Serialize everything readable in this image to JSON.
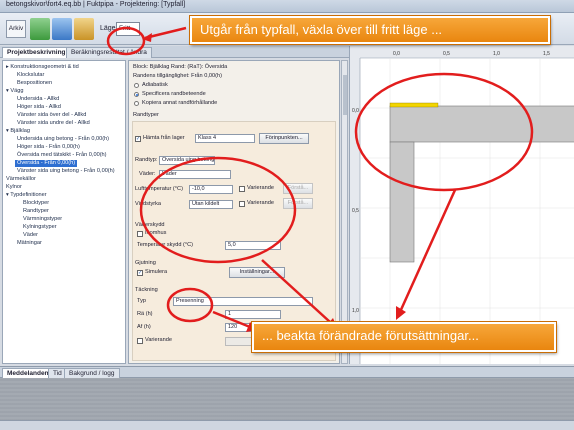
{
  "window": {
    "title": "betongskivor\\fort4.eq.bb | Fuktpipa - Projektering: [Typfall]"
  },
  "toolbar": {
    "arkiv_label": "Arkiv",
    "mode_label": "Läge",
    "mode_value": "Fritt"
  },
  "callouts": {
    "top": "Utgår från typfall, växla över till fritt läge ...",
    "bottom": "... beakta förändrade förutsättningar..."
  },
  "tabs": [
    {
      "label": "Projektbeskrivning"
    },
    {
      "label": "Beräkningsresultat / ändra"
    }
  ],
  "tree": {
    "items": [
      {
        "label": "▸ Konstruktionsgeometri & tid"
      },
      {
        "label": "Klockslutar"
      },
      {
        "label": "Bespositionen"
      },
      {
        "label": "▾ Vägg"
      },
      {
        "label": "Undersida - Allkd"
      },
      {
        "label": "Höger sida - Allkd"
      },
      {
        "label": "Vänster sida över del - Allkd"
      },
      {
        "label": "Vänster sida undre del - Allkd"
      },
      {
        "label": "▾ Bjälklag"
      },
      {
        "label": "Undersida uing betong - Från 0,00(h)"
      },
      {
        "label": "Höger sida - Från 0,00(h)"
      },
      {
        "label": "Översida med tätskikt - Från 0,00(h)"
      },
      {
        "label": "Översida - Från 0,00(h)"
      },
      {
        "label": "Vänster sida uing betong - Från 0,00(h)"
      },
      {
        "label": "Värmekällor"
      },
      {
        "label": "Kylnor"
      },
      {
        "label": "▾ Typdefinitioner"
      },
      {
        "label": "Blocktyper"
      },
      {
        "label": "Randtyper"
      },
      {
        "label": "Värmningstyper"
      },
      {
        "label": "Kylningstyper"
      },
      {
        "label": "Väder"
      },
      {
        "label": "Mätningar"
      }
    ],
    "selected_index": 12
  },
  "props": {
    "header": "Block: Bjälklag  Rand: (RaT):  Översida",
    "subheader": "Randens tillgänglighet: Från 0,00(h)",
    "radio_options": [
      "Adiabatisk",
      "Specificera randbeteende",
      "Kopiera annat randförhållande"
    ],
    "section_randtyper": "Randtyper",
    "check_hamta": "Hämta från lager",
    "klass_value": "Klass 4",
    "klass_btn": "Förinpunkten...",
    "randtyp_label": "Randtyp:",
    "randtyp_value": "Översida uing betong",
    "vader_label": "Väder:",
    "vader_value": "Väder",
    "lufttemp_label": "Lufttemperatur (°C)",
    "lufttemp_value": "-10,0",
    "varierande": "Varierande",
    "forsta_btn": "Förstå...",
    "vind_label": "Vindstyrka",
    "vind_value": "Utan kildelt",
    "avsnitt_vaderskydd": "Väderskydd",
    "inomhus": "Inomhus",
    "temp_label": "Temperatur skydd (°C)",
    "temp_value": "5,0",
    "avsnitt_gjutning": "Gjutning",
    "simulera": "Simulera",
    "installningar_btn": "Inställningar...",
    "avsnitt_tackning": "Täckning",
    "typ_label": "Typ",
    "typ_value": "Presenning",
    "rh_label": "Rä (h)",
    "rh_value": "1",
    "af_label": "Af (h)",
    "af_value": "120",
    "varierande2": "Varierande"
  },
  "canvas": {
    "ruler_labels": [
      "0,0",
      "0,5",
      "1,0",
      "1,5"
    ],
    "ruler_y_labels": [
      "0,0",
      "0,5",
      "1,0"
    ]
  },
  "bottom": {
    "tabs": [
      "Meddelanden",
      "Tid",
      "Bakgrund / logg"
    ]
  },
  "colors": {
    "callout_orange": "#ef9420",
    "arrow_red": "#e21d1d",
    "selection_blue": "#2f6fd1",
    "slab_gray": "#c8c8c8",
    "highlight_yellow": "#f3d500"
  }
}
